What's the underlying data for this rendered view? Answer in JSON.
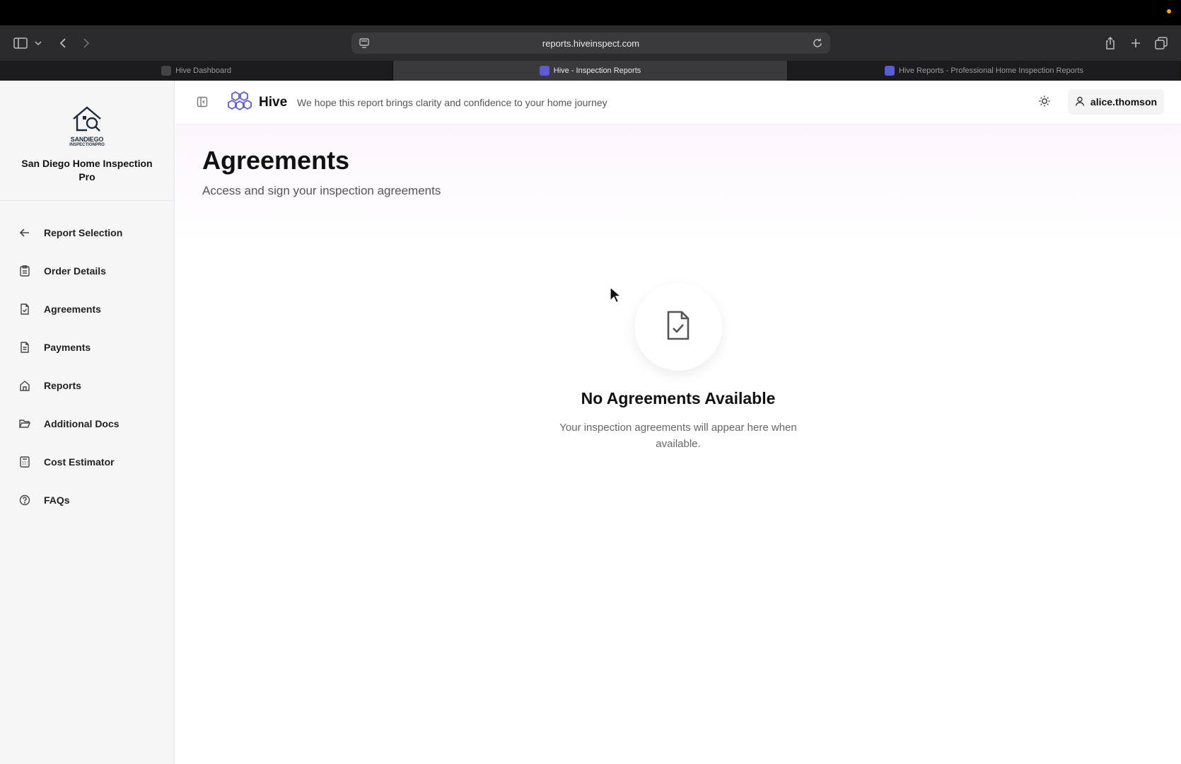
{
  "browser": {
    "url": "reports.hiveinspect.com",
    "tabs": [
      {
        "label": "Hive Dashboard",
        "active": false
      },
      {
        "label": "Hive - Inspection Reports",
        "active": true
      },
      {
        "label": "Hive Reports - Professional Home Inspection Reports",
        "active": false
      }
    ]
  },
  "sidebar": {
    "logo_text_top": "SANDIEGO",
    "logo_text_bottom": "INSPECTIONPRO",
    "company_name": "San Diego Home Inspection Pro",
    "items": [
      {
        "label": "Report Selection",
        "icon": "arrow-left-icon"
      },
      {
        "label": "Order Details",
        "icon": "clipboard-icon"
      },
      {
        "label": "Agreements",
        "icon": "file-check-icon"
      },
      {
        "label": "Payments",
        "icon": "receipt-icon"
      },
      {
        "label": "Reports",
        "icon": "home-icon"
      },
      {
        "label": "Additional Docs",
        "icon": "folder-open-icon"
      },
      {
        "label": "Cost Estimator",
        "icon": "calculator-icon"
      },
      {
        "label": "FAQs",
        "icon": "help-circle-icon"
      }
    ]
  },
  "header": {
    "app_name": "Hive",
    "tagline": "We hope this report brings clarity and confidence to your home journey",
    "username": "alice.thomson"
  },
  "main": {
    "title": "Agreements",
    "subtitle": "Access and sign your inspection agreements",
    "empty_title": "No Agreements Available",
    "empty_text": "Your inspection agreements will appear here when available."
  },
  "colors": {
    "accent": "#5b5bd6",
    "os_indicator": "#f5a623"
  }
}
